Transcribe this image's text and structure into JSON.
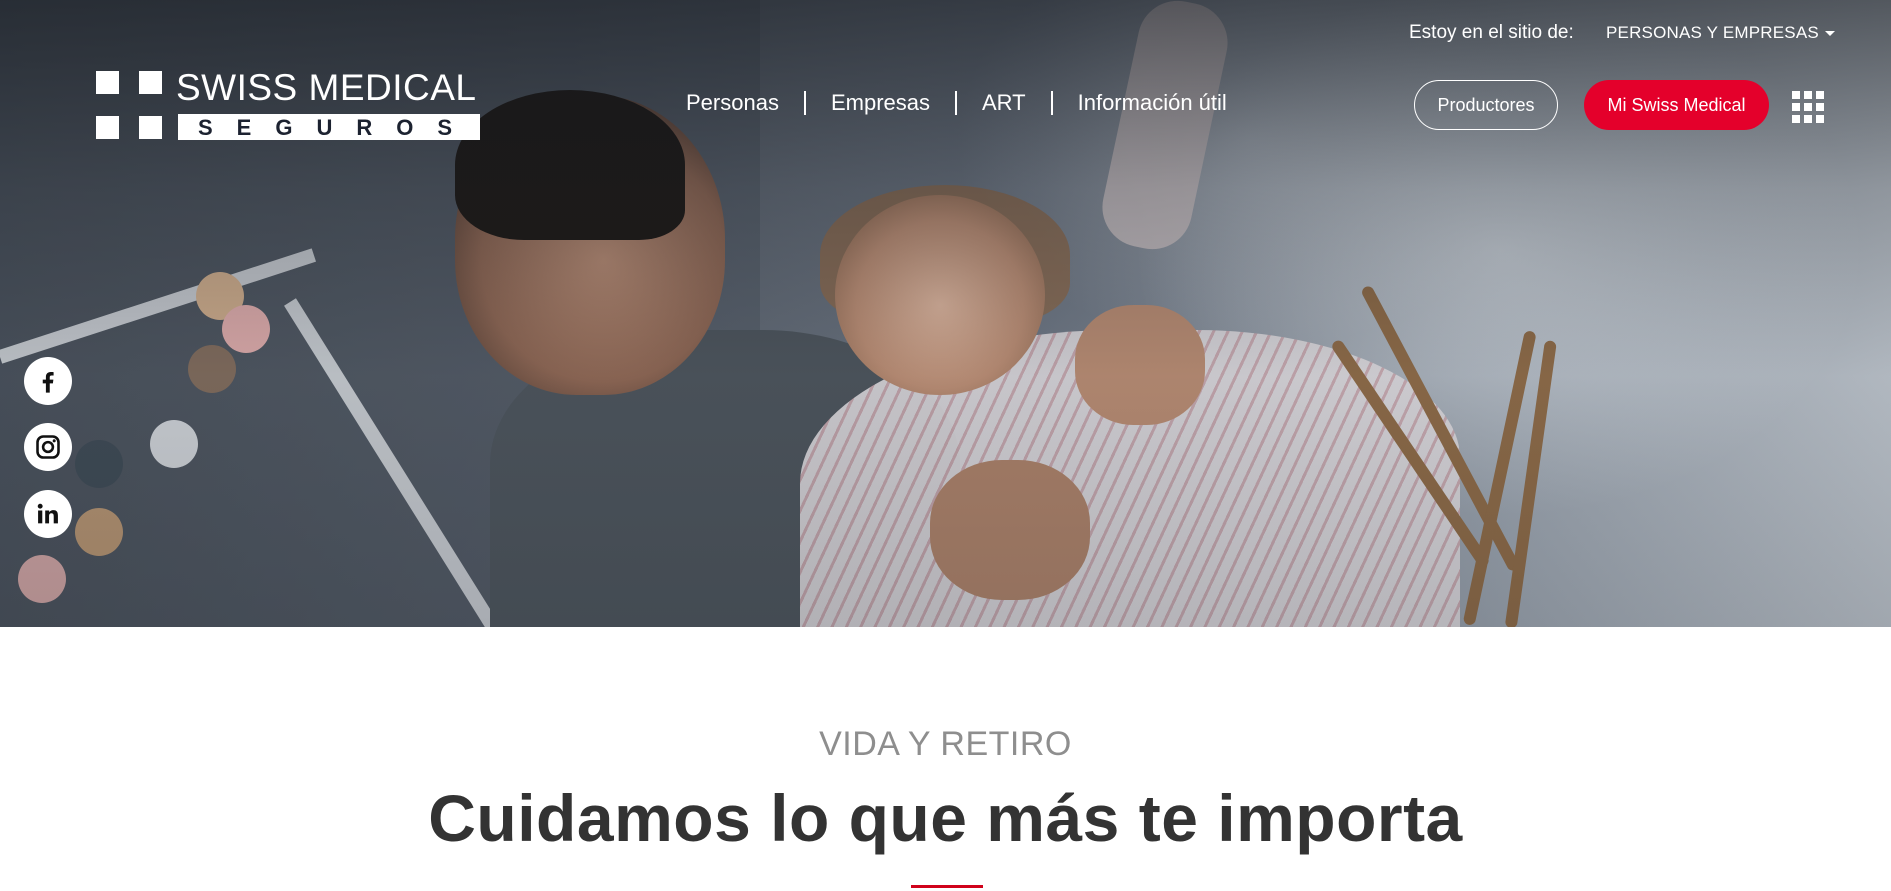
{
  "topbar": {
    "site_label": "Estoy en el sitio de:",
    "site_selected": "PERSONAS Y EMPRESAS"
  },
  "logo": {
    "title": "SWISS MEDICAL",
    "subtitle": "SEGUROS"
  },
  "nav": {
    "items": [
      {
        "label": "Personas"
      },
      {
        "label": "Empresas"
      },
      {
        "label": "ART"
      },
      {
        "label": "Información útil"
      }
    ]
  },
  "header_buttons": {
    "productores": "Productores",
    "mi_swiss_medical": "Mi Swiss Medical"
  },
  "icons": {
    "apps": "grid-icon",
    "social": [
      "facebook-icon",
      "instagram-icon",
      "linkedin-icon"
    ]
  },
  "content": {
    "eyebrow": "VIDA Y RETIRO",
    "headline": "Cuidamos lo que más te importa"
  },
  "colors": {
    "accent_red": "#e4002b",
    "heading": "#333333",
    "eyebrow": "#8e8e8e"
  }
}
